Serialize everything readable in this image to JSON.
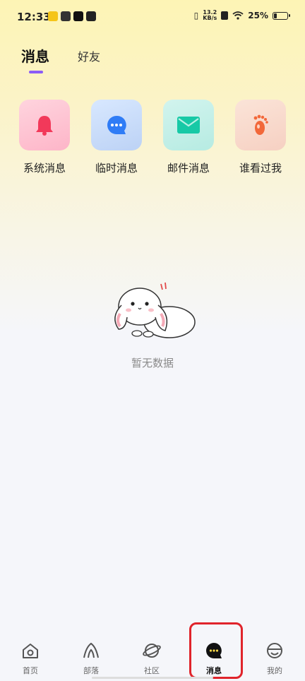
{
  "status_bar": {
    "time": "13.2",
    "time_clock": "12:33",
    "network_speed_value": "13.2",
    "network_speed_unit": "KB/s",
    "battery": "25%",
    "battery_level": 0.25
  },
  "tabs": {
    "active": "消息",
    "inactive": "好友"
  },
  "shortcuts": [
    {
      "label": "系统消息",
      "icon": "bell-icon",
      "color": "#f2395a"
    },
    {
      "label": "临时消息",
      "icon": "chat-bubble-icon",
      "color": "#2f7cf6"
    },
    {
      "label": "邮件消息",
      "icon": "mail-icon",
      "color": "#17c9a6"
    },
    {
      "label": "谁看过我",
      "icon": "footprint-icon",
      "color": "#f2683a"
    }
  ],
  "empty_state": {
    "text": "暂无数据",
    "illustration": "bunny-illustration"
  },
  "bottom_nav": [
    {
      "label": "首页",
      "icon": "home-icon"
    },
    {
      "label": "部落",
      "icon": "tribe-icon"
    },
    {
      "label": "社区",
      "icon": "planet-icon"
    },
    {
      "label": "消息",
      "icon": "message-icon",
      "active": true
    },
    {
      "label": "我的",
      "icon": "profile-face-icon"
    }
  ],
  "colors": {
    "accent": "#8b5cf6",
    "highlight": "#e0242b"
  }
}
